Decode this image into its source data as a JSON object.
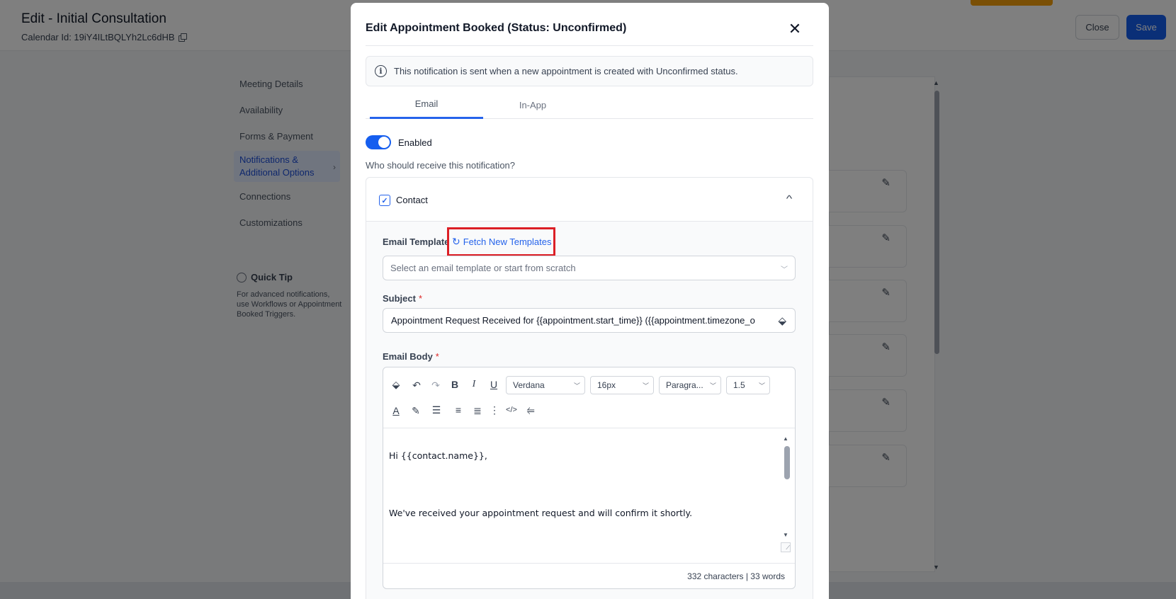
{
  "page": {
    "title": "Edit - Initial Consultation",
    "calendar_id": "Calendar Id: 19iY4ILtBQLYh2Lc6dHB",
    "close_label": "Close",
    "save_label": "Save"
  },
  "sidebar": {
    "items": [
      {
        "label": "Meeting Details"
      },
      {
        "label": "Availability"
      },
      {
        "label": "Forms & Payment"
      },
      {
        "label": "Notifications & Additional Options"
      },
      {
        "label": "Connections"
      },
      {
        "label": "Customizations"
      }
    ],
    "active_index": 3,
    "quick_tip_title": "Quick Tip",
    "quick_tip_text": "For advanced notifications, use Workflows or Appointment Booked Triggers."
  },
  "modal": {
    "title": "Edit Appointment Booked (Status: Unconfirmed)",
    "info_text": "This notification is sent when a new appointment is created with Unconfirmed status.",
    "tabs": [
      {
        "label": "Email",
        "active": true
      },
      {
        "label": "In-App",
        "active": false
      }
    ],
    "toggle_label": "Enabled",
    "toggle_on": true,
    "recipients_label": "Who should receive this notification?",
    "contact": {
      "label": "Contact",
      "checked": true,
      "email_template_label": "Email Template",
      "fetch_label": "Fetch New Templates",
      "template_placeholder": "Select an email template or start from scratch",
      "subject_label": "Subject",
      "subject_value": "Appointment Request Received for {{appointment.start_time}} ({{appointment.timezone_o",
      "body_label": "Email Body",
      "required_mark": "*",
      "toolbar": {
        "font": "Verdana",
        "size": "16px",
        "block": "Paragra...",
        "line_height": "1.5"
      },
      "body_lines": [
        "Hi {{contact.name}},",
        "We've received your appointment request and will confirm it shortly."
      ],
      "counter": "332 characters | 33 words"
    }
  },
  "colors": {
    "primary": "#155eef",
    "highlight_border": "#dc1f26",
    "overlay": "rgba(0,0,0,0.5)"
  }
}
